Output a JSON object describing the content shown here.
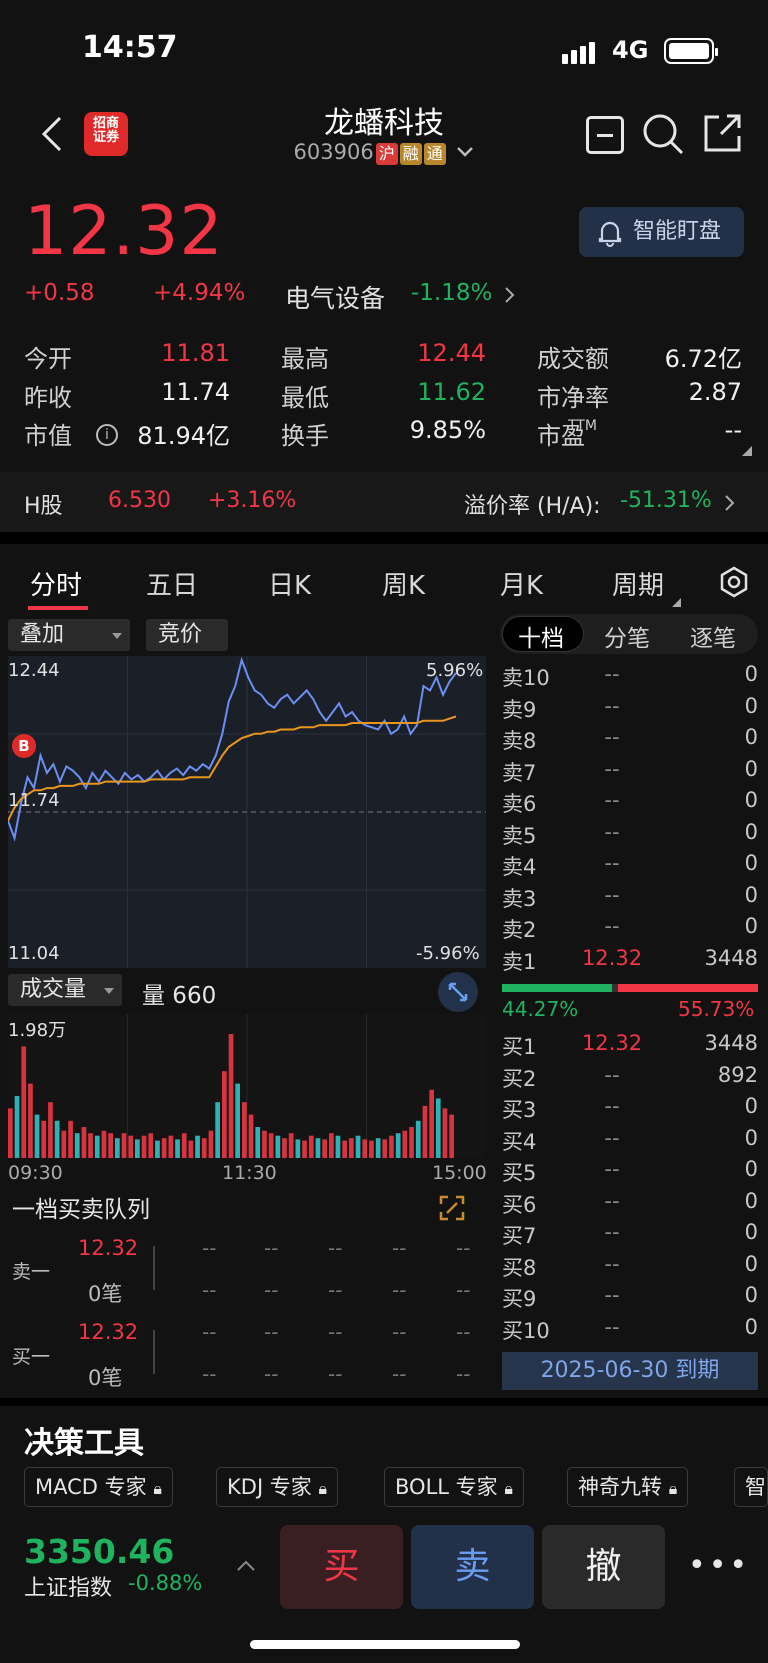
{
  "status": {
    "time": "14:57",
    "network": "4G"
  },
  "header": {
    "title": "龙蟠科技",
    "code": "603906",
    "tags": [
      "沪",
      "融",
      "通"
    ]
  },
  "quote": {
    "price": "12.32",
    "change": "+0.58",
    "change_pct": "+4.94%",
    "sector": "电气设备",
    "sector_pct": "-1.18%",
    "smart_label": "智能盯盘"
  },
  "stats": [
    {
      "label": "今开",
      "value": "11.81",
      "color": "red"
    },
    {
      "label": "最高",
      "value": "12.44",
      "color": "red"
    },
    {
      "label": "成交额",
      "value": "6.72亿",
      "color": "white"
    },
    {
      "label": "昨收",
      "value": "11.74",
      "color": "white"
    },
    {
      "label": "最低",
      "value": "11.62",
      "color": "green"
    },
    {
      "label": "市净率",
      "value": "2.87",
      "color": "white"
    },
    {
      "label": "市值",
      "value": "81.94亿",
      "color": "white"
    },
    {
      "label": "换手",
      "value": "9.85%",
      "color": "white"
    },
    {
      "label": "市盈",
      "value": "--",
      "color": "white"
    }
  ],
  "stats_pe_sup": "TTM",
  "hshare": {
    "label": "H股",
    "price": "6.530",
    "pct": "+3.16%",
    "premium_label": "溢价率 (H/A):",
    "premium": "-51.31%"
  },
  "tabs": [
    "分时",
    "五日",
    "日K",
    "周K",
    "月K",
    "周期"
  ],
  "chart_controls": {
    "overlay": "叠加",
    "auction": "竞价",
    "volume": "成交量",
    "vol_label": "量 660",
    "queue_title": "一档买卖队列"
  },
  "ob_tabs": [
    "十档",
    "分笔",
    "逐笔"
  ],
  "chart_data": {
    "type": "line",
    "ylim": [
      11.04,
      12.44
    ],
    "y_top_label": "12.44",
    "y_mid_label": "11.74",
    "y_bottom_label": "11.04",
    "pct_top": "5.96%",
    "pct_bottom": "-5.96%",
    "prev_close": 11.74,
    "x_labels": [
      "09:30",
      "11:30",
      "15:00"
    ],
    "series": [
      {
        "values": [
          11.7,
          11.62,
          11.78,
          11.9,
          11.85,
          12.0,
          11.92,
          11.96,
          11.88,
          11.95,
          11.93,
          11.9,
          11.85,
          11.92,
          11.88,
          11.93,
          11.9,
          11.87,
          11.92,
          11.89,
          11.91,
          11.88,
          11.9,
          11.93,
          11.89,
          11.92,
          11.94,
          11.91,
          11.95,
          11.93,
          11.96,
          11.94,
          12.0,
          12.1,
          12.25,
          12.32,
          12.44,
          12.36,
          12.3,
          12.28,
          12.24,
          12.22,
          12.26,
          12.28,
          12.24,
          12.27,
          12.3,
          12.26,
          12.2,
          12.16,
          12.2,
          12.24,
          12.18,
          12.2,
          12.16,
          12.14,
          12.13,
          12.12,
          12.16,
          12.1,
          12.12,
          12.18,
          12.1,
          12.14,
          12.32,
          12.3,
          12.36,
          12.28,
          12.34,
          12.38
        ],
        "color": "#6c8ff2"
      },
      {
        "values": [
          11.7,
          11.76,
          11.8,
          11.82,
          11.84,
          11.84,
          11.85,
          11.85,
          11.86,
          11.86,
          11.86,
          11.87,
          11.87,
          11.87,
          11.87,
          11.88,
          11.88,
          11.88,
          11.88,
          11.88,
          11.88,
          11.88,
          11.89,
          11.89,
          11.89,
          11.89,
          11.89,
          11.89,
          11.9,
          11.9,
          11.9,
          11.9,
          11.95,
          12.0,
          12.04,
          12.06,
          12.08,
          12.09,
          12.1,
          12.1,
          12.11,
          12.11,
          12.12,
          12.12,
          12.12,
          12.13,
          12.13,
          12.13,
          12.14,
          12.14,
          12.14,
          12.14,
          12.14,
          12.15,
          12.15,
          12.15,
          12.15,
          12.15,
          12.15,
          12.15,
          12.15,
          12.15,
          12.15,
          12.15,
          12.16,
          12.16,
          12.16,
          12.16,
          12.17,
          12.18
        ],
        "color": "#e8961e"
      }
    ],
    "volume_max_label": "1.98万",
    "volume": [
      0.4,
      0.5,
      0.9,
      0.6,
      0.35,
      0.3,
      0.45,
      0.3,
      0.22,
      0.3,
      0.2,
      0.25,
      0.2,
      0.18,
      0.22,
      0.2,
      0.16,
      0.2,
      0.18,
      0.15,
      0.18,
      0.2,
      0.14,
      0.16,
      0.18,
      0.15,
      0.2,
      0.14,
      0.18,
      0.16,
      0.22,
      0.45,
      0.7,
      1.0,
      0.6,
      0.45,
      0.35,
      0.25,
      0.22,
      0.2,
      0.18,
      0.16,
      0.2,
      0.15,
      0.14,
      0.18,
      0.16,
      0.15,
      0.2,
      0.18,
      0.14,
      0.16,
      0.18,
      0.15,
      0.14,
      0.16,
      0.15,
      0.18,
      0.2,
      0.22,
      0.25,
      0.3,
      0.42,
      0.55,
      0.48,
      0.4,
      0.35
    ]
  },
  "order_book": {
    "asks": [
      {
        "l": "卖10",
        "p": "--",
        "v": "0"
      },
      {
        "l": "卖9",
        "p": "--",
        "v": "0"
      },
      {
        "l": "卖8",
        "p": "--",
        "v": "0"
      },
      {
        "l": "卖7",
        "p": "--",
        "v": "0"
      },
      {
        "l": "卖6",
        "p": "--",
        "v": "0"
      },
      {
        "l": "卖5",
        "p": "--",
        "v": "0"
      },
      {
        "l": "卖4",
        "p": "--",
        "v": "0"
      },
      {
        "l": "卖3",
        "p": "--",
        "v": "0"
      },
      {
        "l": "卖2",
        "p": "--",
        "v": "0"
      },
      {
        "l": "卖1",
        "p": "12.32",
        "v": "3448"
      }
    ],
    "buy_pct": "44.27%",
    "sell_pct": "55.73%",
    "buy_frac": 0.4427,
    "bids": [
      {
        "l": "买1",
        "p": "12.32",
        "v": "3448"
      },
      {
        "l": "买2",
        "p": "--",
        "v": "892"
      },
      {
        "l": "买3",
        "p": "--",
        "v": "0"
      },
      {
        "l": "买4",
        "p": "--",
        "v": "0"
      },
      {
        "l": "买5",
        "p": "--",
        "v": "0"
      },
      {
        "l": "买6",
        "p": "--",
        "v": "0"
      },
      {
        "l": "买7",
        "p": "--",
        "v": "0"
      },
      {
        "l": "买8",
        "p": "--",
        "v": "0"
      },
      {
        "l": "买9",
        "p": "--",
        "v": "0"
      },
      {
        "l": "买10",
        "p": "--",
        "v": "0"
      }
    ],
    "expiry": "2025-06-30 到期"
  },
  "queue": {
    "sell_label": "卖一",
    "sell_price": "12.32",
    "sell_count": "0笔",
    "buy_label": "买一",
    "buy_price": "12.32",
    "buy_count": "0笔",
    "dash": "--"
  },
  "tools": {
    "title": "决策工具",
    "chips": [
      "MACD 专家",
      "KDJ 专家",
      "BOLL 专家",
      "神奇九转",
      "智"
    ]
  },
  "bottom": {
    "index_value": "3350.46",
    "index_name": "上证指数",
    "index_pct": "-0.88%",
    "buy": "买",
    "sell": "卖",
    "cancel": "撤"
  }
}
